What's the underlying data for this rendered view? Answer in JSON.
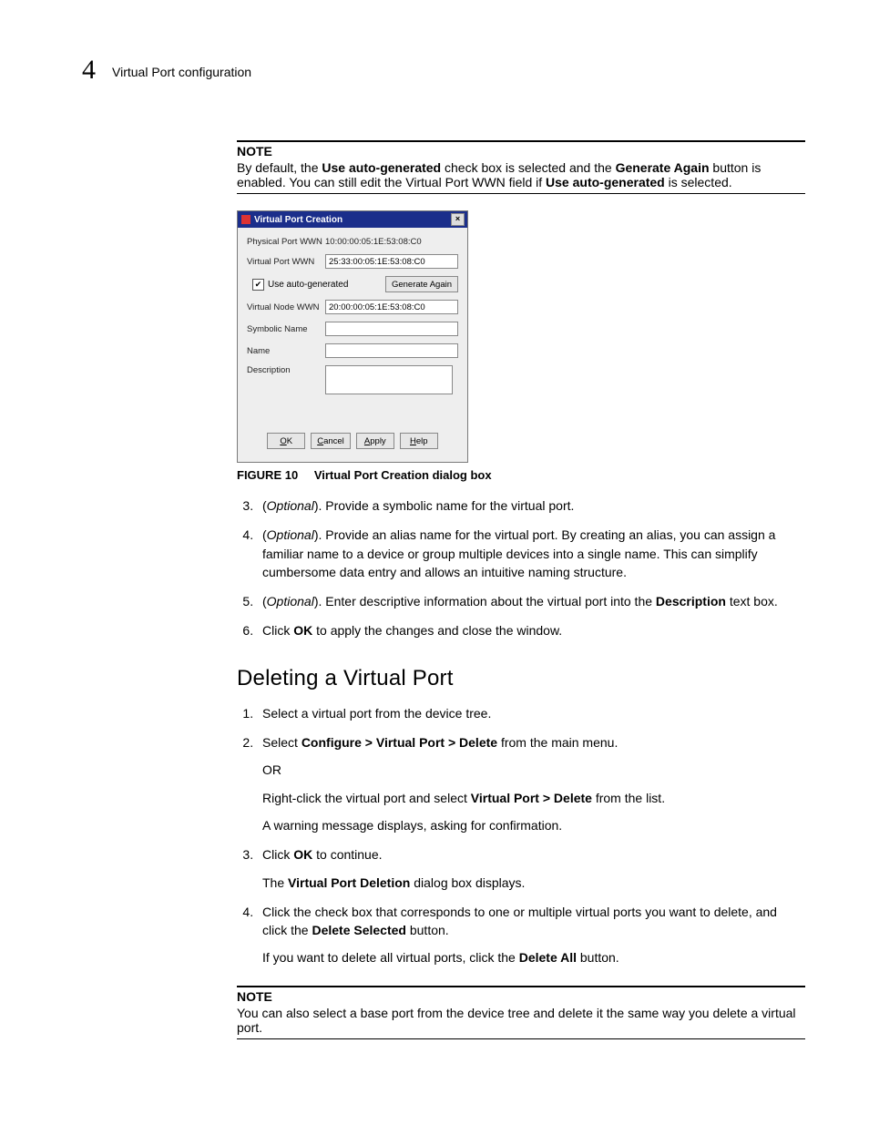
{
  "header": {
    "chapter_number": "4",
    "chapter_title": "Virtual Port configuration"
  },
  "note1": {
    "heading": "NOTE",
    "pre": "By default, the ",
    "bold1": "Use auto-generated",
    "mid1": " check box is selected and the ",
    "bold2": "Generate Again",
    "mid2": " button is enabled. You can still edit the Virtual Port WWN field if ",
    "bold3": "Use auto-generated",
    "post": " is selected."
  },
  "dialog": {
    "title": "Virtual Port Creation",
    "labels": {
      "phys": "Physical Port WWN",
      "vport": "Virtual Port WWN",
      "check": "Use auto-generated",
      "gen": "Generate Again",
      "vnode": "Virtual Node WWN",
      "sym": "Symbolic Name",
      "name": "Name",
      "desc": "Description"
    },
    "values": {
      "phys": "10:00:00:05:1E:53:08:C0",
      "vport": "25:33:00:05:1E:53:08:C0",
      "vnode": "20:00:00:05:1E:53:08:C0"
    },
    "buttons": {
      "ok": "OK",
      "cancel": "Cancel",
      "apply": "Apply",
      "help": "Help"
    }
  },
  "figure": {
    "label": "FIGURE 10",
    "caption": "Virtual Port Creation dialog box"
  },
  "stepsA": {
    "s3": {
      "prefix": "(",
      "opt": "Optional",
      "suffix": "). Provide a symbolic name for the virtual port."
    },
    "s4": {
      "prefix": "(",
      "opt": "Optional",
      "suffix": "). Provide an alias name for the virtual port. By creating an alias, you can assign a familiar name to a device or group multiple devices into a single name. This can simplify cumbersome data entry and allows an intuitive naming structure."
    },
    "s5": {
      "prefix": "(",
      "opt": "Optional",
      "mid": "). Enter descriptive information about the virtual port into the ",
      "bold": "Description",
      "post": " text box."
    },
    "s6": {
      "pre": "Click ",
      "bold": "OK",
      "post": " to apply the changes and close the window."
    }
  },
  "section2": {
    "title": "Deleting a Virtual Port"
  },
  "stepsB": {
    "s1": "Select a virtual port from the device tree.",
    "s2": {
      "pre": "Select ",
      "bold": "Configure > Virtual Port > Delete",
      "post": " from the main menu.",
      "or": "OR",
      "line2_pre": "Right-click the virtual port and select ",
      "line2_bold": "Virtual Port > Delete",
      "line2_post": " from the list.",
      "line3": "A warning message displays, asking for confirmation."
    },
    "s3": {
      "pre": "Click ",
      "bold": "OK",
      "post": " to continue.",
      "line2_pre": "The ",
      "line2_bold": "Virtual Port Deletion",
      "line2_post": " dialog box displays."
    },
    "s4": {
      "pre": "Click the check box that corresponds to one or multiple virtual ports you want to delete, and click the ",
      "bold": "Delete Selected",
      "post": " button.",
      "line2_pre": "If you want to delete all virtual ports, click the ",
      "line2_bold": "Delete All",
      "line2_post": " button."
    }
  },
  "note2": {
    "heading": "NOTE",
    "body": "You can also select a base port from the device tree and delete it the same way you delete a virtual port."
  }
}
